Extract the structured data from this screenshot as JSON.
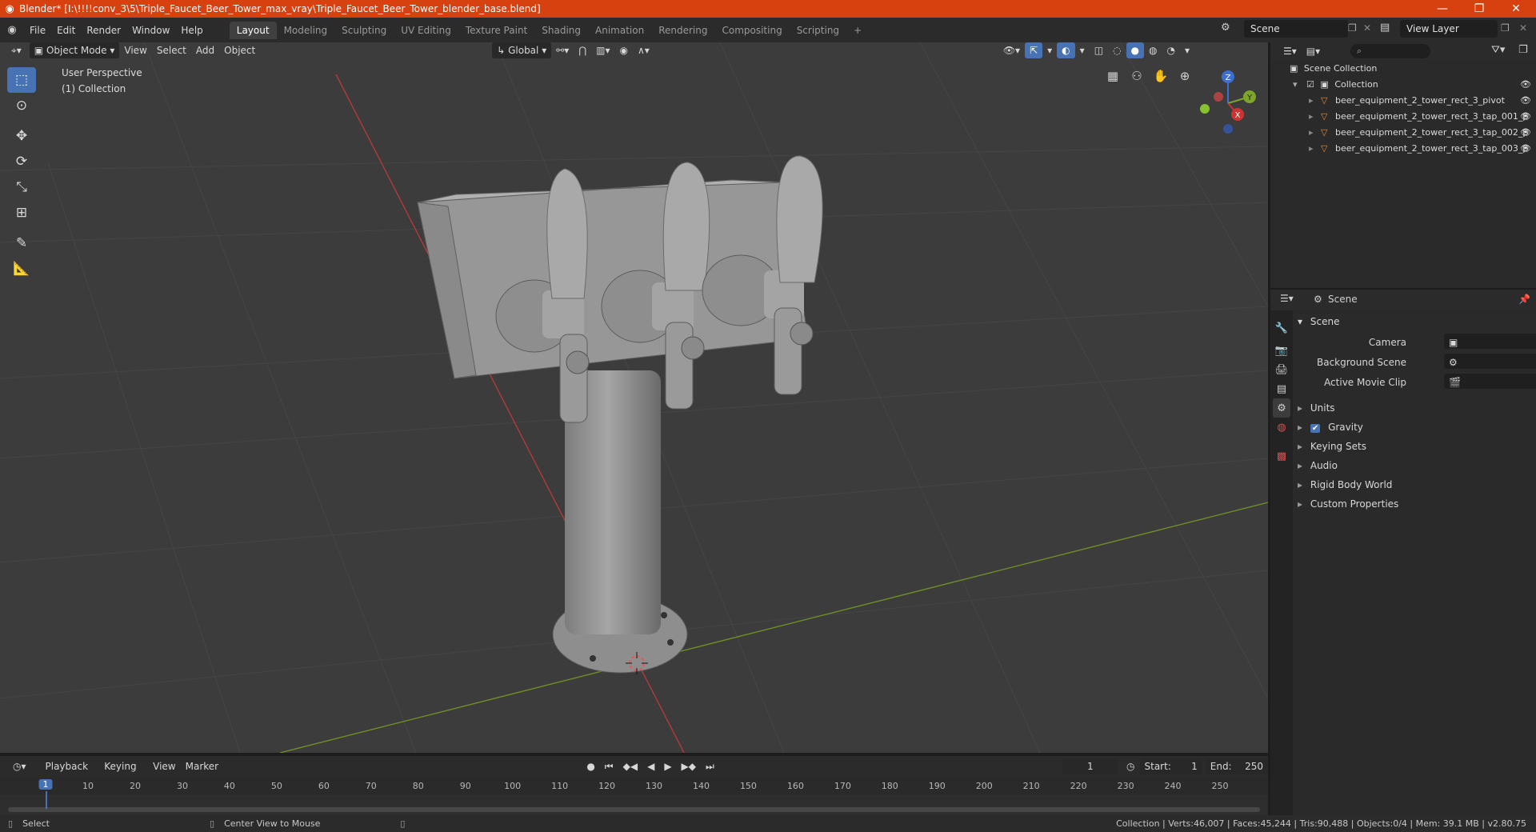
{
  "window": {
    "title": "Blender* [I:\\!!!!conv_3\\5\\Triple_Faucet_Beer_Tower_max_vray\\Triple_Faucet_Beer_Tower_blender_base.blend]",
    "minimize": "—",
    "restore": "❐",
    "close": "✕"
  },
  "menu": [
    "File",
    "Edit",
    "Render",
    "Window",
    "Help"
  ],
  "workspaces": [
    "Layout",
    "Modeling",
    "Sculpting",
    "UV Editing",
    "Texture Paint",
    "Shading",
    "Animation",
    "Rendering",
    "Compositing",
    "Scripting"
  ],
  "add_workspace": "+",
  "scene_field": "Scene",
  "view_layer_field": "View Layer",
  "viewport_header": {
    "mode": "Object Mode",
    "menus": [
      "View",
      "Select",
      "Add",
      "Object"
    ],
    "transform_orientation": "Global"
  },
  "viewport": {
    "perspective": "User Perspective",
    "collection": "(1) Collection",
    "gizmo": {
      "x": "X",
      "y": "Y",
      "z": "Z"
    }
  },
  "timeline": {
    "menus": [
      "Playback",
      "Keying",
      "View",
      "Marker"
    ],
    "current_frame": "1",
    "start_label": "Start:",
    "start": "1",
    "end_label": "End:",
    "end": "250",
    "ticks": [
      "1",
      "10",
      "20",
      "30",
      "40",
      "50",
      "60",
      "70",
      "80",
      "90",
      "100",
      "110",
      "120",
      "130",
      "140",
      "150",
      "160",
      "170",
      "180",
      "190",
      "200",
      "210",
      "220",
      "230",
      "240",
      "250"
    ],
    "tick_values": [
      1,
      10,
      20,
      30,
      40,
      50,
      60,
      70,
      80,
      90,
      100,
      110,
      120,
      130,
      140,
      150,
      160,
      170,
      180,
      190,
      200,
      210,
      220,
      230,
      240,
      250
    ]
  },
  "status": {
    "select": "Select",
    "center_view": "Center View to Mouse",
    "stats": "Collection | Verts:46,007 | Faces:45,244 | Tris:90,488 | Objects:0/4 | Mem: 39.1 MB | v2.80.75"
  },
  "outliner": {
    "root": "Scene Collection",
    "collection": "Collection",
    "objects": [
      "beer_equipment_2_tower_rect_3_pivot",
      "beer_equipment_2_tower_rect_3_tap_001_p",
      "beer_equipment_2_tower_rect_3_tap_002_p",
      "beer_equipment_2_tower_rect_3_tap_003_p"
    ]
  },
  "properties": {
    "context": "Scene",
    "panel": "Scene",
    "fields": [
      {
        "label": "Camera"
      },
      {
        "label": "Background Scene"
      },
      {
        "label": "Active Movie Clip"
      }
    ],
    "sections": [
      "Units",
      "Gravity",
      "Keying Sets",
      "Audio",
      "Rigid Body World",
      "Custom Properties"
    ]
  },
  "colors": {
    "titlebar": "#d7400f",
    "accent": "#4772b3",
    "x_axis": "#cc3333",
    "y_axis": "#7da626"
  }
}
